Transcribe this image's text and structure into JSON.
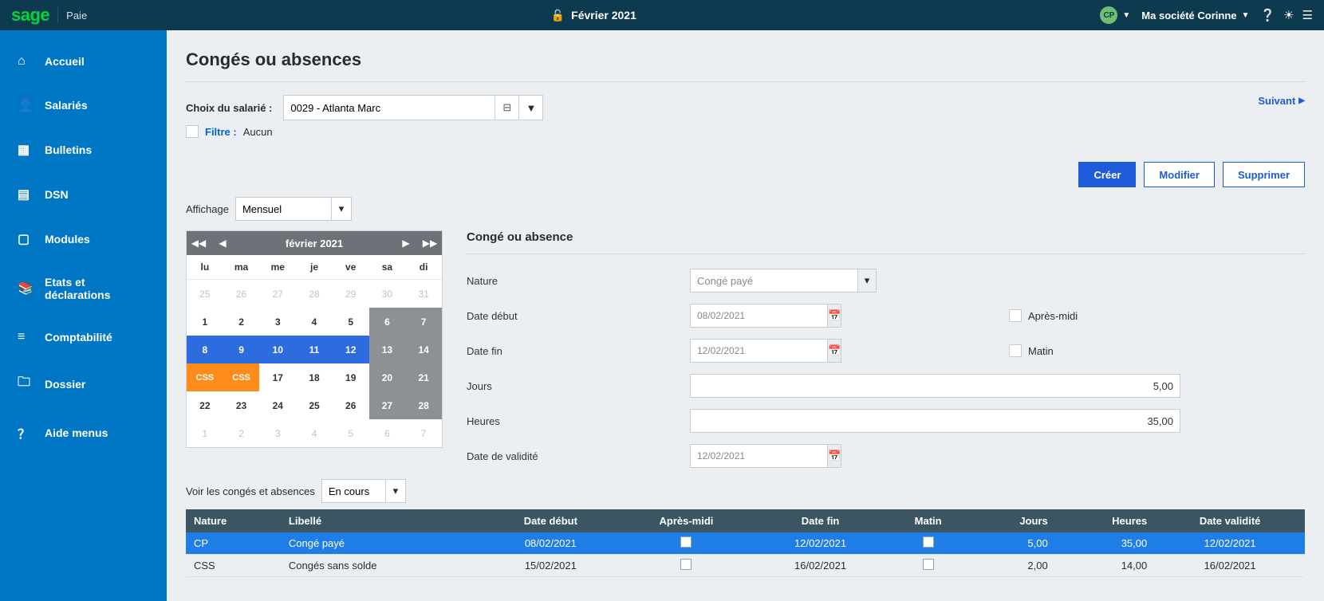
{
  "topbar": {
    "brand": "sage",
    "module": "Paie",
    "period": "Février 2021",
    "avatar_initials": "CP",
    "company": "Ma société Corinne"
  },
  "sidebar": {
    "items": [
      {
        "icon": "home",
        "label": "Accueil"
      },
      {
        "icon": "user",
        "label": "Salariés"
      },
      {
        "icon": "grid",
        "label": "Bulletins"
      },
      {
        "icon": "doc",
        "label": "DSN"
      },
      {
        "icon": "module",
        "label": "Modules"
      },
      {
        "icon": "book",
        "label": "Etats et déclarations"
      },
      {
        "icon": "list",
        "label": "Comptabilité"
      },
      {
        "icon": "folder",
        "label": "Dossier"
      },
      {
        "icon": "help",
        "label": "Aide menus"
      }
    ]
  },
  "page": {
    "title": "Congés ou absences",
    "employee_label": "Choix du salarié :",
    "employee_value": "0029 - Atlanta Marc",
    "filter_label": "Filtre :",
    "filter_value": "Aucun",
    "next": "Suivant",
    "view_label": "Affichage",
    "view_value": "Mensuel",
    "view2_label": "Voir les congés et absences",
    "view2_value": "En cours"
  },
  "actions": {
    "create": "Créer",
    "modify": "Modifier",
    "delete": "Supprimer"
  },
  "calendar": {
    "title": "février 2021",
    "dow": [
      "lu",
      "ma",
      "me",
      "je",
      "ve",
      "sa",
      "di"
    ],
    "css_label": "CSS",
    "cells": [
      {
        "t": "25",
        "cls": "other"
      },
      {
        "t": "26",
        "cls": "other"
      },
      {
        "t": "27",
        "cls": "other"
      },
      {
        "t": "28",
        "cls": "other"
      },
      {
        "t": "29",
        "cls": "other"
      },
      {
        "t": "30",
        "cls": "other"
      },
      {
        "t": "31",
        "cls": "other"
      },
      {
        "t": "1"
      },
      {
        "t": "2"
      },
      {
        "t": "3"
      },
      {
        "t": "4"
      },
      {
        "t": "5"
      },
      {
        "t": "6",
        "cls": "wkend"
      },
      {
        "t": "7",
        "cls": "wkend"
      },
      {
        "t": "8",
        "cls": "sel"
      },
      {
        "t": "9",
        "cls": "sel"
      },
      {
        "t": "10",
        "cls": "sel"
      },
      {
        "t": "11",
        "cls": "sel"
      },
      {
        "t": "12",
        "cls": "sel"
      },
      {
        "t": "13",
        "cls": "wkend"
      },
      {
        "t": "14",
        "cls": "wkend"
      },
      {
        "t": "CSS",
        "cls": "css"
      },
      {
        "t": "CSS",
        "cls": "css"
      },
      {
        "t": "17"
      },
      {
        "t": "18"
      },
      {
        "t": "19"
      },
      {
        "t": "20",
        "cls": "wkend"
      },
      {
        "t": "21",
        "cls": "wkend"
      },
      {
        "t": "22"
      },
      {
        "t": "23"
      },
      {
        "t": "24"
      },
      {
        "t": "25"
      },
      {
        "t": "26"
      },
      {
        "t": "27",
        "cls": "wkend"
      },
      {
        "t": "28",
        "cls": "wkend"
      },
      {
        "t": "1",
        "cls": "other"
      },
      {
        "t": "2",
        "cls": "other"
      },
      {
        "t": "3",
        "cls": "other"
      },
      {
        "t": "4",
        "cls": "other"
      },
      {
        "t": "5",
        "cls": "other"
      },
      {
        "t": "6",
        "cls": "other"
      },
      {
        "t": "7",
        "cls": "other"
      }
    ]
  },
  "form": {
    "title": "Congé ou absence",
    "nature_label": "Nature",
    "nature_value": "Congé payé",
    "date_start_label": "Date début",
    "date_start_value": "08/02/2021",
    "afternoon_label": "Après-midi",
    "date_end_label": "Date fin",
    "date_end_value": "12/02/2021",
    "morning_label": "Matin",
    "days_label": "Jours",
    "days_value": "5,00",
    "hours_label": "Heures",
    "hours_value": "35,00",
    "validity_label": "Date de validité",
    "validity_value": "12/02/2021"
  },
  "table": {
    "headers": [
      "Nature",
      "Libellé",
      "Date début",
      "Après-midi",
      "Date fin",
      "Matin",
      "Jours",
      "Heures",
      "Date validité"
    ],
    "rows": [
      {
        "selected": true,
        "nature": "CP",
        "libelle": "Congé payé",
        "dd": "08/02/2021",
        "am": false,
        "df": "12/02/2021",
        "matin": false,
        "jours": "5,00",
        "heures": "35,00",
        "dv": "12/02/2021"
      },
      {
        "selected": false,
        "nature": "CSS",
        "libelle": "Congés sans solde",
        "dd": "15/02/2021",
        "am": false,
        "df": "16/02/2021",
        "matin": false,
        "jours": "2,00",
        "heures": "14,00",
        "dv": "16/02/2021"
      }
    ]
  }
}
